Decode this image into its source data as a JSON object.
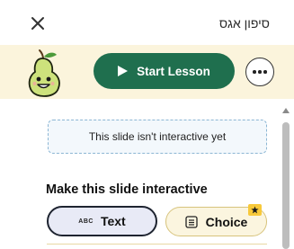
{
  "header": {
    "title": "סיפון אגס",
    "close_icon": "close-icon"
  },
  "toolbar": {
    "start_label": "Start Lesson",
    "start_icon": "play-icon",
    "more_icon": "more-icon",
    "mascot": "pear-mascot",
    "accent_color": "#1f6f4e"
  },
  "main": {
    "notice": "This slide isn't interactive yet",
    "heading": "Make this slide interactive",
    "options": [
      {
        "label": "Text",
        "icon": "abc-icon",
        "icon_text": "ABC",
        "selected": true
      },
      {
        "label": "Choice",
        "icon": "list-icon",
        "badge_icon": "star-icon",
        "selected": false
      }
    ]
  }
}
